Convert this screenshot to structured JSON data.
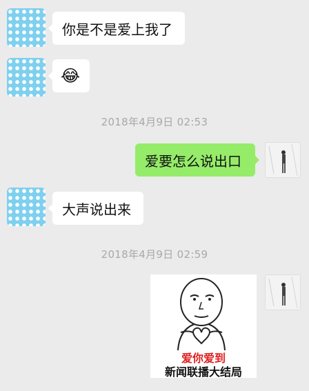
{
  "messages": [
    {
      "side": "left",
      "text": "你是不是爱上我了"
    },
    {
      "side": "left",
      "text": "😂",
      "icon": "tears-of-joy-emoji-icon"
    },
    {
      "timestamp": "2018年4月9日 02:53"
    },
    {
      "side": "right",
      "text": "爱要怎么说出口"
    },
    {
      "side": "left",
      "text": "大声说出来"
    },
    {
      "timestamp": "2018年4月9日 02:59"
    },
    {
      "side": "right",
      "sticker": {
        "line1": "爱你爱到",
        "line2": "新闻联播大结局",
        "icon": "meme-face-heart-hands-sticker"
      }
    }
  ],
  "colors": {
    "background": "#ebebeb",
    "incoming_bubble": "#ffffff",
    "outgoing_bubble": "#95ec69",
    "timestamp": "#a8a8a8",
    "avatar_left": "#7fd0ef",
    "sticker_highlight": "#e02020"
  }
}
